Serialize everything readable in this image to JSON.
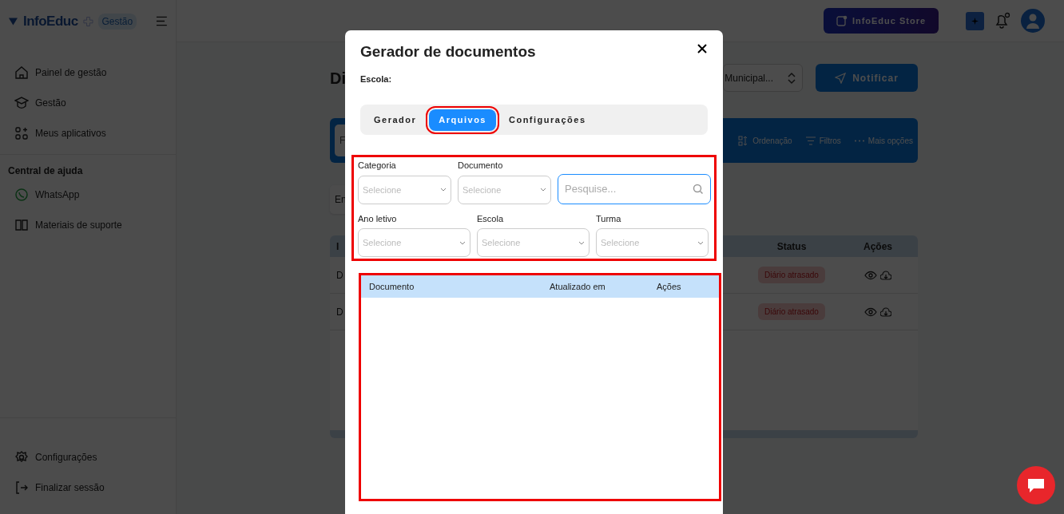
{
  "header": {
    "logo": "InfoEduc",
    "badge": "Gestão",
    "store_button": "InfoEduc Store"
  },
  "sidebar": {
    "items": [
      {
        "label": "Painel de gestão"
      },
      {
        "label": "Gestão"
      },
      {
        "label": "Meus aplicativos"
      }
    ],
    "help_title": "Central de ajuda",
    "help_items": [
      {
        "label": "WhatsApp"
      },
      {
        "label": "Materiais de suporte"
      }
    ],
    "footer_items": [
      {
        "label": "Configurações"
      },
      {
        "label": "Finalizar sessão"
      }
    ]
  },
  "page": {
    "title": "Di",
    "select": "Municipal...",
    "notify_button": "Notificar",
    "search_placeholder": "F",
    "toolbar": [
      "Ordenação",
      "Filtros",
      "Mais opções"
    ],
    "card_text": "En",
    "table": {
      "columns": [
        "I",
        "Status",
        "Ações"
      ],
      "rows": [
        {
          "cell": "D",
          "status": "Diário atrasado"
        },
        {
          "cell": "D",
          "status": "Diário atrasado"
        }
      ]
    }
  },
  "modal": {
    "title": "Gerador de documentos",
    "school_label": "Escola:",
    "tabs": [
      {
        "label": "Gerador",
        "selected": false
      },
      {
        "label": "Arquivos",
        "selected": true
      },
      {
        "label": "Configurações",
        "selected": false
      }
    ],
    "filters_row1": [
      {
        "label": "Categoria",
        "placeholder": "Selecione"
      },
      {
        "label": "Documento",
        "placeholder": "Selecione"
      }
    ],
    "search": {
      "placeholder": "Pesquise..."
    },
    "filters_row2": [
      {
        "label": "Ano letivo",
        "placeholder": "Selecione"
      },
      {
        "label": "Escola",
        "placeholder": "Selecione"
      },
      {
        "label": "Turma",
        "placeholder": "Selecione"
      }
    ],
    "table": {
      "columns": [
        "Documento",
        "Atualizado em",
        "Ações"
      ]
    }
  }
}
